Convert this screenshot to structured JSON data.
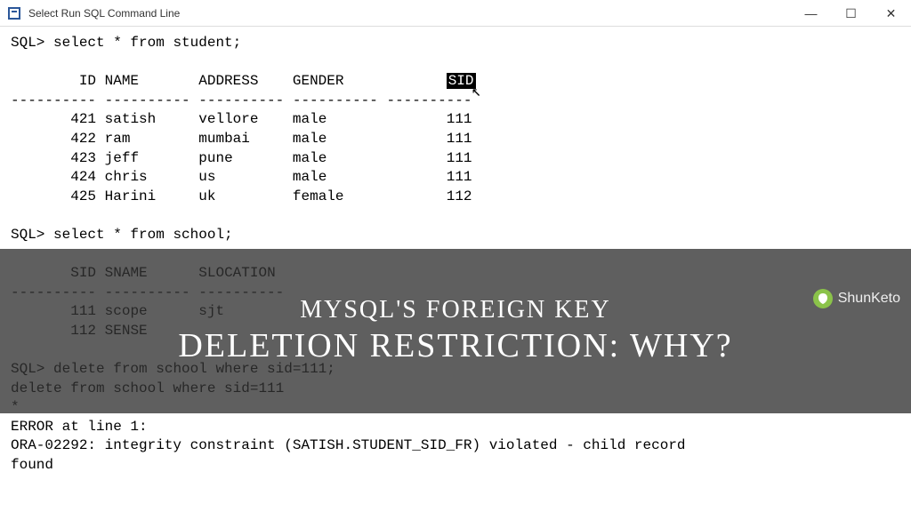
{
  "window": {
    "title": "Select Run SQL Command Line"
  },
  "terminal": {
    "prompt": "SQL>",
    "query1": "select * from student;",
    "student_headers": [
      "ID",
      "NAME",
      "ADDRESS",
      "GENDER",
      "SID"
    ],
    "student_rows": [
      {
        "id": 421,
        "name": "satish",
        "address": "vellore",
        "gender": "male",
        "sid": 111
      },
      {
        "id": 422,
        "name": "ram",
        "address": "mumbai",
        "gender": "male",
        "sid": 111
      },
      {
        "id": 423,
        "name": "jeff",
        "address": "pune",
        "gender": "male",
        "sid": 111
      },
      {
        "id": 424,
        "name": "chris",
        "address": "us",
        "gender": "male",
        "sid": 111
      },
      {
        "id": 425,
        "name": "Harini",
        "address": "uk",
        "gender": "female",
        "sid": 112
      }
    ],
    "query2": "select * from school;",
    "school_headers": [
      "SID",
      "SNAME",
      "SLOCATION"
    ],
    "school_rows": [
      {
        "sid": 111,
        "sname": "scope",
        "slocation": "sjt"
      },
      {
        "sid": 112,
        "sname": "SENSE",
        "slocation": ""
      }
    ],
    "query3": "delete from school where sid=111;",
    "echo3": "delete from school where sid=111",
    "star": "*",
    "error_header": "ERROR at line 1:",
    "error_body1": "ORA-02292: integrity constraint (SATISH.STUDENT_SID_FR) violated - child record",
    "error_body2": "found"
  },
  "overlay": {
    "line1": "MYSQL'S FOREIGN KEY",
    "line2": "DELETION RESTRICTION: WHY?"
  },
  "watermark": {
    "text": "ShunKeto"
  },
  "colors": {
    "overlay_bg": "rgba(50,50,50,0.78)",
    "highlight_bg": "#000000",
    "highlight_fg": "#ffffff"
  }
}
